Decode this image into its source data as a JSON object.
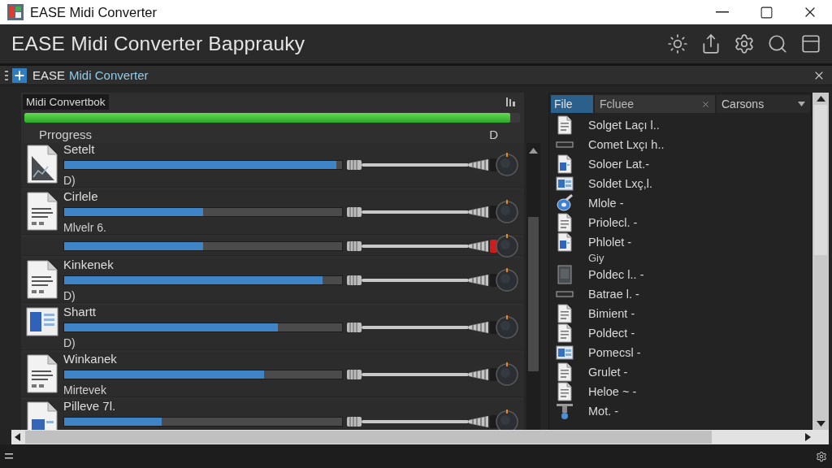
{
  "window": {
    "title": "EASE Midi Converter"
  },
  "header": {
    "title": "EASE Midi Converter Bapprauky"
  },
  "document_tab": {
    "prefix": "EASE",
    "highlight": "Midi Converter"
  },
  "left_panel": {
    "title": "Midi Convertbok",
    "progress": {
      "level": 0.98
    },
    "progress_label": "Prrogress",
    "progress_reading": "D",
    "channels": [
      {
        "kind": "chart",
        "name": "Setelt",
        "level": 0.98,
        "active": false,
        "note": "D)"
      },
      {
        "kind": "document",
        "name": "Cirlele",
        "level": 0.5,
        "active": false,
        "note": "Mlvelr 6."
      },
      {
        "level": 0.5,
        "active": true
      },
      {
        "kind": "document",
        "name": "Kinkenek",
        "level": 0.93,
        "active": false,
        "note": "D)"
      },
      {
        "kind": "window",
        "name": "Shartt",
        "level": 0.77,
        "active": false,
        "note": "D)"
      },
      {
        "kind": "document",
        "name": "Winkanek",
        "level": 0.72,
        "active": false,
        "note": "Mirtevek"
      },
      {
        "kind": "blue-document",
        "name": "Pilleve 7l.",
        "level": 0.35,
        "active": false
      }
    ]
  },
  "right_panel": {
    "tabs": [
      {
        "label": "File",
        "selected": true
      }
    ],
    "filter": {
      "value": "Fcluee"
    },
    "sort": {
      "value": "Carsons"
    },
    "files": [
      {
        "kind": "document",
        "name": "Solget Laçı l.."
      },
      {
        "kind": "strip",
        "name": "Comet Lxçı h.."
      },
      {
        "kind": "blue-document",
        "name": "Soloer Lat.-"
      },
      {
        "kind": "image",
        "name": "Soldet Lxç,l."
      },
      {
        "kind": "disc",
        "name": "Mlole -"
      },
      {
        "kind": "document",
        "name": "Priolecl. -"
      },
      {
        "kind": "blue-document",
        "name": "Phlolet -",
        "detail": "Giy"
      },
      {
        "kind": "device",
        "name": "Poldec l.. -"
      },
      {
        "kind": "strip",
        "name": "Batrae l. -"
      },
      {
        "kind": "document",
        "name": "Bimient -"
      },
      {
        "kind": "document",
        "name": "Poldect -"
      },
      {
        "kind": "image",
        "name": "Pomecsl -"
      },
      {
        "kind": "document",
        "name": "Grulet -"
      },
      {
        "kind": "document",
        "name": "Heloe ~ -"
      },
      {
        "kind": "tool",
        "name": "Mot. -"
      }
    ]
  }
}
